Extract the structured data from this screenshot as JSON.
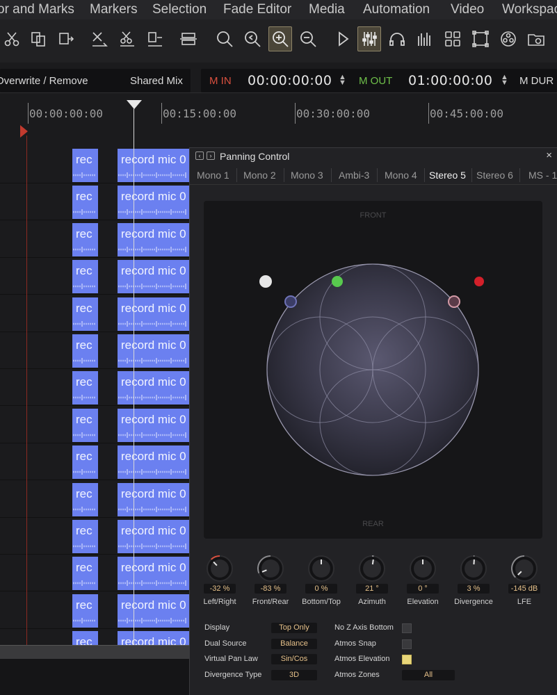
{
  "menu": [
    "or and Marks",
    "Markers",
    "Selection",
    "Fade Editor",
    "Media",
    "Automation",
    "Video",
    "Workspac"
  ],
  "toolbar": {
    "icons": [
      "scissors-icon",
      "copy-icon",
      "paste-icon",
      "cut-delete-icon",
      "cut-all-icon",
      "paste-all-icon",
      "loop-icon",
      "zoom-icon",
      "zoom-out-fit-icon",
      "zoom-in-icon",
      "zoom-out-icon",
      "play-icon",
      "mixer-icon",
      "headphones-icon",
      "meters-icon",
      "grid-icon",
      "frame-icon",
      "film-reel-icon",
      "folder-icon"
    ]
  },
  "timebar": {
    "overwrite_label": "Overwrite / Remove",
    "shared_mix_label": "Shared Mix",
    "m_in_label": "M IN",
    "m_in_value": "00:00:00:00",
    "m_out_label": "M OUT",
    "m_out_value": "01:00:00:00",
    "m_dur_label": "M DUR",
    "colors": {
      "m_in": "#d9503f",
      "m_out": "#6fc04a"
    }
  },
  "ruler": {
    "labels": [
      "00:00:00:00",
      "00:15:00:00",
      "00:30:00:00",
      "00:45:00:00"
    ]
  },
  "tracks": {
    "clip_short_label": "rec",
    "clip_long_label": "record mic 0",
    "clip_color": "#6b80f0",
    "count": 14
  },
  "panel": {
    "title": "Panning Control",
    "close": "×",
    "tabs": [
      "Mono 1",
      "Mono 2",
      "Mono 3",
      "Ambi-3",
      "Mono 4",
      "Stereo 5",
      "Stereo 6",
      "MS - 1"
    ],
    "active_tab": "Stereo 5",
    "pan_front": "FRONT",
    "pan_rear": "REAR",
    "knobs": [
      {
        "value": "-32 %",
        "label": "Left/Right",
        "level": -0.32
      },
      {
        "value": "-83 %",
        "label": "Front/Rear",
        "level": -0.83
      },
      {
        "value": "0 %",
        "label": "Bottom/Top",
        "level": 0.0
      },
      {
        "value": "21 °",
        "label": "Azimuth",
        "level": 0.06
      },
      {
        "value": "0 °",
        "label": "Elevation",
        "level": 0.0
      },
      {
        "value": "3 %",
        "label": "Divergence",
        "level": 0.03
      },
      {
        "value": "-145 dB",
        "label": "LFE",
        "level": -1.0
      }
    ],
    "settings": {
      "display_label": "Display",
      "display_value": "Top Only",
      "dual_source_label": "Dual Source",
      "dual_source_value": "Balance",
      "pan_law_label": "Virtual Pan Law",
      "pan_law_value": "Sin/Cos",
      "divergence_type_label": "Divergence Type",
      "divergence_type_value": "3D",
      "no_z_label": "No Z Axis Bottom",
      "atmos_snap_label": "Atmos Snap",
      "atmos_elevation_label": "Atmos Elevation",
      "atmos_zones_label": "Atmos Zones",
      "atmos_zones_value": "All",
      "no_z_checked": false,
      "atmos_snap_checked": false,
      "atmos_elevation_checked": true
    },
    "speaker_colors": {
      "white": "#e6e6e6",
      "green": "#58c94e",
      "red": "#d3202a",
      "blue_ring": "#6f73b8",
      "pink_ring": "#d39aa6"
    }
  }
}
